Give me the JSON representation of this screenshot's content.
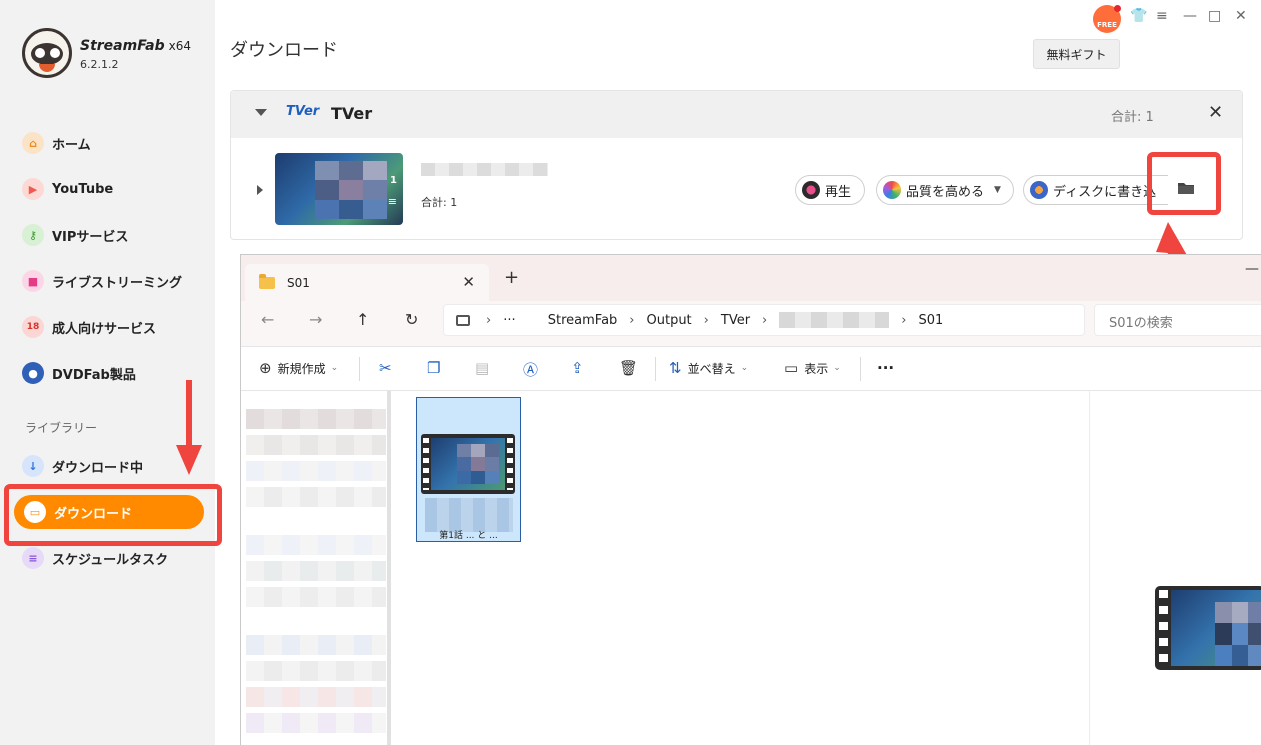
{
  "app": {
    "name": "StreamFab",
    "arch": "x64",
    "version": "6.2.1.2",
    "free_badge": "FREE",
    "gift_button": "無料ギフト"
  },
  "sidebar": {
    "items": [
      {
        "label": "ホーム",
        "icon": "home-icon",
        "color": "#f5a340"
      },
      {
        "label": "YouTube",
        "icon": "youtube-icon",
        "color": "#f05a4f"
      },
      {
        "label": "VIPサービス",
        "icon": "key-icon",
        "color": "#5bb94c"
      },
      {
        "label": "ライブストリーミング",
        "icon": "live-camera-icon",
        "color": "#f04a8a"
      },
      {
        "label": "成人向けサービス",
        "icon": "adult-18-icon",
        "color": "#e8423c"
      },
      {
        "label": "DVDFab製品",
        "icon": "dvdfab-icon",
        "color": "#3a6fd0"
      }
    ],
    "library_label": "ライブラリー",
    "library_items": [
      {
        "label": "ダウンロード中",
        "icon": "download-arrow-icon",
        "color": "#3b82e0"
      },
      {
        "label": "ダウンロード",
        "icon": "folder-icon",
        "color": "#ff8a00",
        "active": true
      },
      {
        "label": "スケジュールタスク",
        "icon": "schedule-list-icon",
        "color": "#a46ee0"
      }
    ]
  },
  "main": {
    "title": "ダウンロード",
    "group": {
      "service": "TVer",
      "logo_text": "TVer",
      "total": "合計: 1",
      "item": {
        "thumb_count": "1",
        "total": "合計: 1",
        "actions": {
          "play": "再生",
          "enhance": "品質を高める",
          "burn": "ディスクに書き込"
        }
      }
    }
  },
  "explorer": {
    "tab_title": "S01",
    "path": [
      "StreamFab",
      "Output",
      "TVer",
      "S01"
    ],
    "search_placeholder": "S01の検索",
    "toolbar": {
      "new": "新規作成",
      "sort": "並べ替え",
      "view": "表示",
      "more": "···"
    },
    "file_caption": "第1話 ... と ..."
  },
  "colors": {
    "accent": "#ff8a00",
    "highlight": "#f0443e",
    "selection": "#cce6fb"
  }
}
